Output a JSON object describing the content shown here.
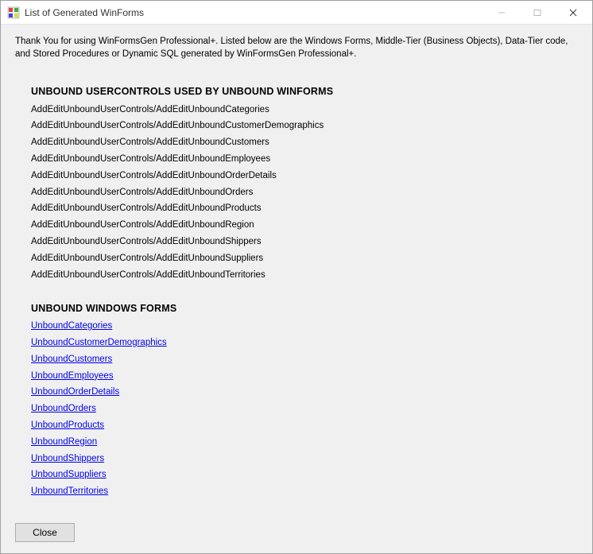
{
  "window": {
    "title": "List of Generated WinForms"
  },
  "intro": "Thank You for using WinFormsGen Professional+. Listed below are the Windows Forms,  Middle-Tier (Business Objects), Data-Tier code, and Stored Procedures or Dynamic SQL generated by WinFormsGen Professional+.",
  "section1": {
    "heading": "UNBOUND USERCONTROLS USED BY UNBOUND WINFORMS",
    "items": [
      "AddEditUnboundUserControls/AddEditUnboundCategories",
      "AddEditUnboundUserControls/AddEditUnboundCustomerDemographics",
      "AddEditUnboundUserControls/AddEditUnboundCustomers",
      "AddEditUnboundUserControls/AddEditUnboundEmployees",
      "AddEditUnboundUserControls/AddEditUnboundOrderDetails",
      "AddEditUnboundUserControls/AddEditUnboundOrders",
      "AddEditUnboundUserControls/AddEditUnboundProducts",
      "AddEditUnboundUserControls/AddEditUnboundRegion",
      "AddEditUnboundUserControls/AddEditUnboundShippers",
      "AddEditUnboundUserControls/AddEditUnboundSuppliers",
      "AddEditUnboundUserControls/AddEditUnboundTerritories"
    ]
  },
  "section2": {
    "heading": "UNBOUND WINDOWS FORMS",
    "items": [
      "UnboundCategories",
      "UnboundCustomerDemographics",
      "UnboundCustomers",
      "UnboundEmployees",
      "UnboundOrderDetails",
      "UnboundOrders",
      "UnboundProducts",
      "UnboundRegion",
      "UnboundShippers",
      "UnboundSuppliers",
      "UnboundTerritories"
    ]
  },
  "footer": {
    "close_label": "Close"
  }
}
